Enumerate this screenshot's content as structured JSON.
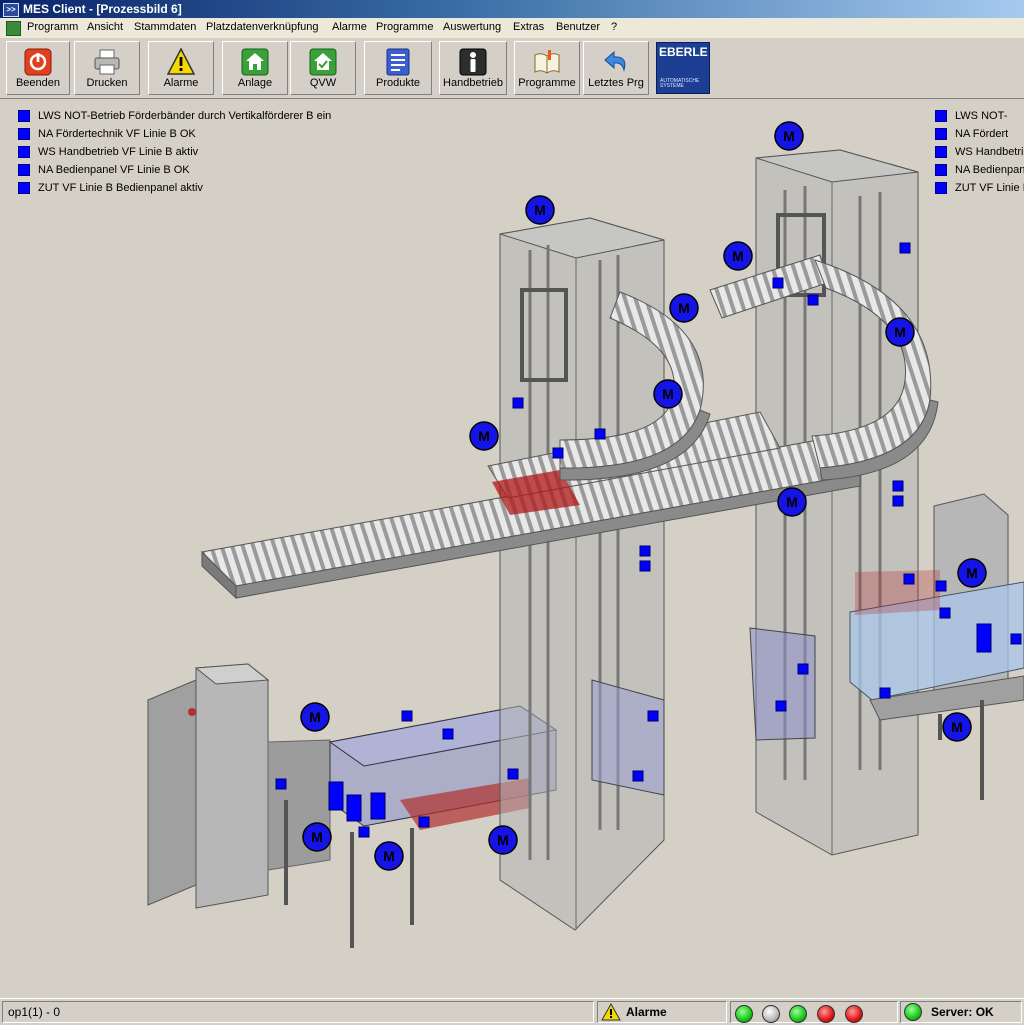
{
  "window": {
    "title": "MES Client - [Prozessbild 6]"
  },
  "menu": [
    "Programm",
    "Ansicht",
    "Stammdaten",
    "Platzdatenverknüpfung",
    "Alarme",
    "Programme",
    "Auswertung",
    "Extras",
    "Benutzer",
    "?"
  ],
  "toolbar": {
    "beenden": "Beenden",
    "drucken": "Drucken",
    "alarme": "Alarme",
    "anlage": "Anlage",
    "qvw": "QVW",
    "produkte": "Produkte",
    "handbetrieb": "Handbetrieb",
    "programme": "Programme",
    "letztes": "Letztes Prg"
  },
  "logo": {
    "name": "EBERLE",
    "tagline1": "AUTOMATISCHE",
    "tagline2": "SYSTEME"
  },
  "messages_left": [
    "LWS NOT-Betrieb Förderbänder durch Vertikalförderer B ein",
    "NA Fördertechnik VF Linie B OK",
    "WS Handbetrieb VF Linie B aktiv",
    "NA Bedienpanel VF Linie B OK",
    "ZUT VF Linie B Bedienpanel aktiv"
  ],
  "messages_right": [
    "LWS NOT-",
    "NA Fördert",
    "WS Handbetri",
    "NA Bedienpan",
    "ZUT VF Linie I"
  ],
  "motor_label": "M",
  "status": {
    "user": "op1(1) - 0",
    "alarm_label": "Alarme",
    "server": "Server: OK"
  },
  "colors": {
    "sensor": "#0000ff",
    "motor": "#1414e6",
    "lamp_green": "#17c617",
    "lamp_grey": "#b8b8b8",
    "lamp_red": "#e01414",
    "conveyor_red": "#b01818"
  }
}
